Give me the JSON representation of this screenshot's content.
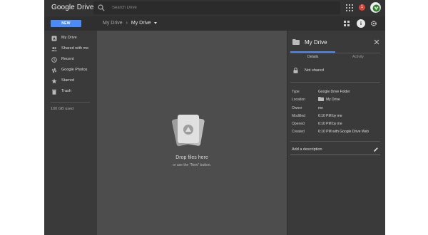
{
  "header": {
    "logo_google": "Google",
    "logo_drive": "Drive",
    "search_placeholder": "Search Drive",
    "notification_count": "1"
  },
  "toolbar": {
    "new_label": "NEW",
    "breadcrumb_root": "My Drive",
    "breadcrumb_current": "My Drive",
    "info_glyph": "i"
  },
  "sidebar": {
    "items": [
      {
        "label": "My Drive",
        "icon": "my-drive-icon"
      },
      {
        "label": "Shared with me",
        "icon": "people-icon"
      },
      {
        "label": "Recent",
        "icon": "clock-icon"
      },
      {
        "label": "Google Photos",
        "icon": "pinwheel-icon"
      },
      {
        "label": "Starred",
        "icon": "star-icon"
      },
      {
        "label": "Trash",
        "icon": "trash-icon"
      }
    ],
    "storage": "100 GB used"
  },
  "main": {
    "drop_title": "Drop files here",
    "drop_subtitle": "or use the \"New\" button."
  },
  "details": {
    "title": "My Drive",
    "tabs": [
      "Details",
      "Activity"
    ],
    "sharing": "Not shared",
    "properties": [
      {
        "key": "Type",
        "value": "Google Drive Folder"
      },
      {
        "key": "Location",
        "value": "My Drive"
      },
      {
        "key": "Owner",
        "value": "me"
      },
      {
        "key": "Modified",
        "value": "6:10 PM by me"
      },
      {
        "key": "Opened",
        "value": "6:10 PM by me"
      },
      {
        "key": "Created",
        "value": "6:10 PM with Google Drive Web"
      }
    ],
    "add_description": "Add a description"
  },
  "colors": {
    "accent": "#4c8bf5",
    "notification": "#db4437",
    "app_background": "#3a3a3a",
    "main_background": "#4d4d4d"
  }
}
